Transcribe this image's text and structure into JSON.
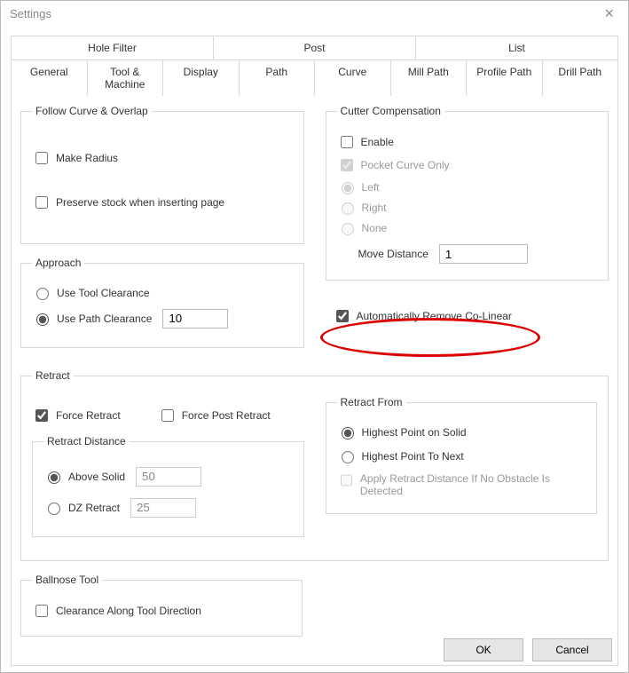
{
  "title": "Settings",
  "tabs_row1": [
    "Hole Filter",
    "Post",
    "List"
  ],
  "tabs_row2": [
    "General",
    "Tool & Machine",
    "Display",
    "Path",
    "Curve",
    "Mill Path",
    "Profile Path",
    "Drill Path"
  ],
  "follow_curve": {
    "legend": "Follow Curve & Overlap",
    "make_radius": "Make Radius",
    "preserve_stock": "Preserve stock when inserting page"
  },
  "approach": {
    "legend": "Approach",
    "use_tool": "Use Tool Clearance",
    "use_path": "Use Path Clearance",
    "value": "10"
  },
  "cutter": {
    "legend": "Cutter Compensation",
    "enable": "Enable",
    "pocket": "Pocket Curve Only",
    "left": "Left",
    "right": "Right",
    "none": "None",
    "move_dist": "Move Distance",
    "move_dist_val": "1"
  },
  "auto_colinear": "Automatically Remove Co-Linear",
  "retract": {
    "legend": "Retract",
    "force": "Force Retract",
    "force_post": "Force Post Retract",
    "dist_legend": "Retract Distance",
    "above_solid": "Above Solid",
    "above_val": "50",
    "dz": "DZ Retract",
    "dz_val": "25"
  },
  "retract_from": {
    "legend": "Retract From",
    "highest_solid": "Highest Point on Solid",
    "highest_next": "Highest Point To Next",
    "apply": "Apply Retract Distance If No Obstacle Is Detected"
  },
  "ballnose": {
    "legend": "Ballnose Tool",
    "clearance": "Clearance Along Tool Direction"
  },
  "buttons": {
    "ok": "OK",
    "cancel": "Cancel"
  }
}
